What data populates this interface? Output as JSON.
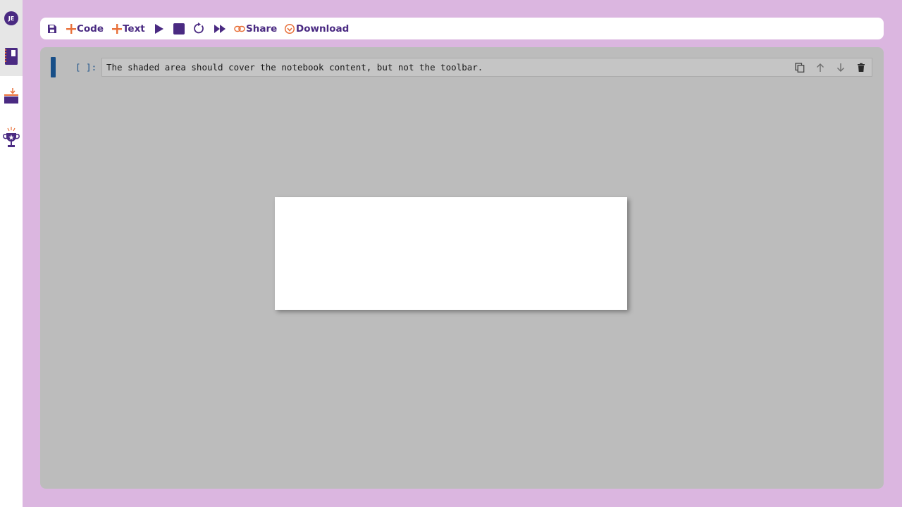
{
  "sidebar": {
    "avatar_initials": "JE",
    "icons": [
      "notebook-icon",
      "download-tray-icon",
      "trophy-icon"
    ]
  },
  "toolbar": {
    "save_icon": "save-icon",
    "add_code_label": "Code",
    "add_text_label": "Text",
    "run_icon": "play-icon",
    "stop_icon": "stop-icon",
    "restart_icon": "restart-icon",
    "run_all_icon": "fast-forward-icon",
    "share_label": "Share",
    "download_label": "Download"
  },
  "notebook": {
    "cells": [
      {
        "prompt": "[ ]:",
        "source": "The shaded area should cover the notebook content, but not the toolbar.",
        "tools": [
          "copy-icon",
          "move-up-icon",
          "move-down-icon",
          "delete-icon"
        ]
      }
    ]
  },
  "colors": {
    "background": "#dbb6e0",
    "brand_purple": "#4a2a82",
    "accent_orange": "#e8703a",
    "cell_marker_blue": "#1e62a8"
  }
}
